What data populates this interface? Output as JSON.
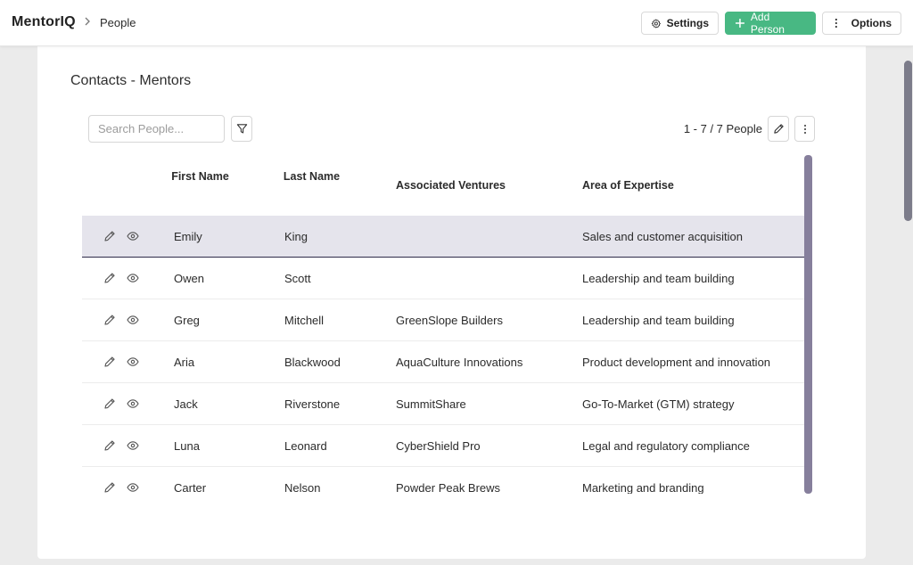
{
  "header": {
    "brand": "MentorIQ",
    "breadcrumb": "People",
    "settings_label": "Settings",
    "add_label": "Add Person",
    "options_label": "Options"
  },
  "page": {
    "title": "Contacts - Mentors"
  },
  "toolbar": {
    "search_placeholder": "Search People...",
    "search_value": "",
    "count_text": "1 - 7 / 7 People"
  },
  "table": {
    "columns": {
      "first": "First Name",
      "last": "Last Name",
      "ventures": "Associated Ventures",
      "expertise": "Area of Expertise"
    },
    "rows": [
      {
        "first": "Emily",
        "last": "King",
        "ventures": "",
        "expertise": "Sales and customer acquisition"
      },
      {
        "first": "Owen",
        "last": "Scott",
        "ventures": "",
        "expertise": "Leadership and team building"
      },
      {
        "first": "Greg",
        "last": "Mitchell",
        "ventures": "GreenSlope Builders",
        "expertise": "Leadership and team building"
      },
      {
        "first": "Aria",
        "last": "Blackwood",
        "ventures": "AquaCulture Innovations",
        "expertise": "Product development and innovation"
      },
      {
        "first": "Jack",
        "last": "Riverstone",
        "ventures": "SummitShare",
        "expertise": "Go-To-Market (GTM) strategy"
      },
      {
        "first": "Luna",
        "last": "Leonard",
        "ventures": "CyberShield Pro",
        "expertise": "Legal and regulatory compliance"
      },
      {
        "first": "Carter",
        "last": "Nelson",
        "ventures": "Powder Peak Brews",
        "expertise": "Marketing and branding"
      }
    ]
  },
  "colors": {
    "accent_green": "#48b883",
    "selected_row": "#e5e4ec",
    "scrollbar": "#867f9c"
  },
  "icons": [
    "chevron-right-icon",
    "gear-icon",
    "plus-icon",
    "vertical-dots-icon",
    "filter-icon",
    "pencil-icon",
    "eye-icon"
  ]
}
